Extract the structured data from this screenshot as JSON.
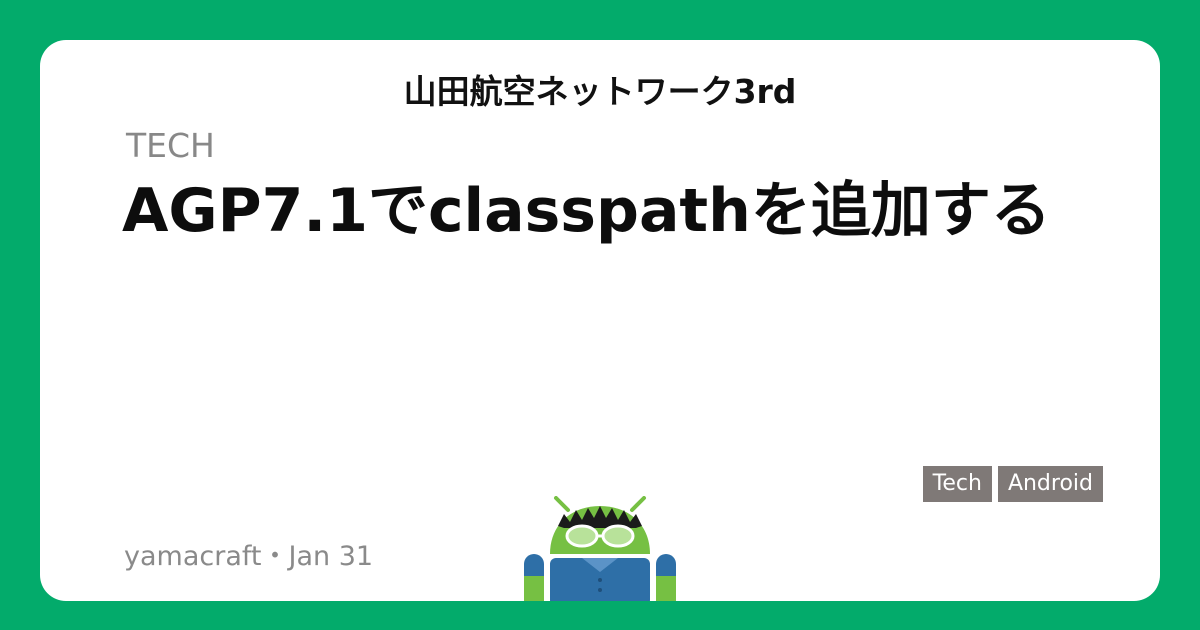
{
  "site": {
    "title": "山田航空ネットワーク3rd"
  },
  "post": {
    "category": "TECH",
    "title": "AGP7.1でclasspathを追加する",
    "author": "yamacraft",
    "separator": "・",
    "date": "Jan 31"
  },
  "tags": [
    "Tech",
    "Android"
  ],
  "colors": {
    "background": "#03ab6b",
    "card": "#ffffff",
    "tag": "#7f7977",
    "mascot_green": "#76c043",
    "mascot_shirt": "#2e6fa7"
  },
  "mascot": {
    "icon": "android-mascot-icon"
  }
}
